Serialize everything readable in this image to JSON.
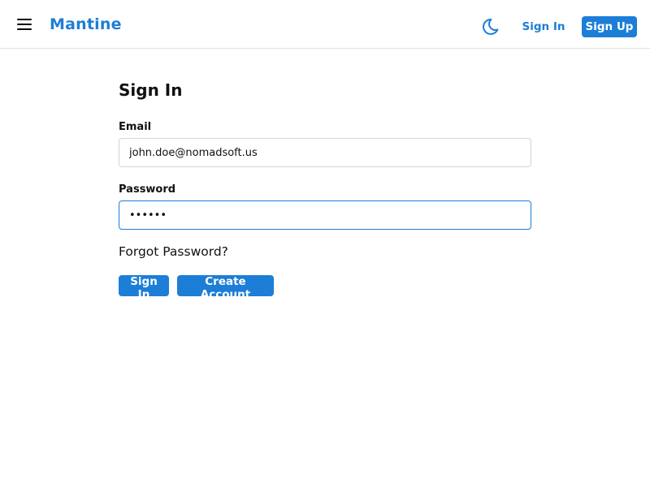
{
  "header": {
    "brand": "Mantine",
    "menu_icon": "hamburger-menu-icon",
    "theme_icon": "moon-icon",
    "sign_in_label": "Sign In",
    "sign_up_label": "Sign Up"
  },
  "form": {
    "title": "Sign In",
    "email_label": "Email",
    "email_value": "john.doe@nomadsoft.us",
    "password_label": "Password",
    "password_value": "••••••",
    "forgot_label": "Forgot Password?",
    "submit_label": "Sign In",
    "create_label": "Create Account"
  },
  "colors": {
    "accent": "#1c7ed6",
    "border": "#ced4da",
    "divider": "#dee2e6"
  }
}
